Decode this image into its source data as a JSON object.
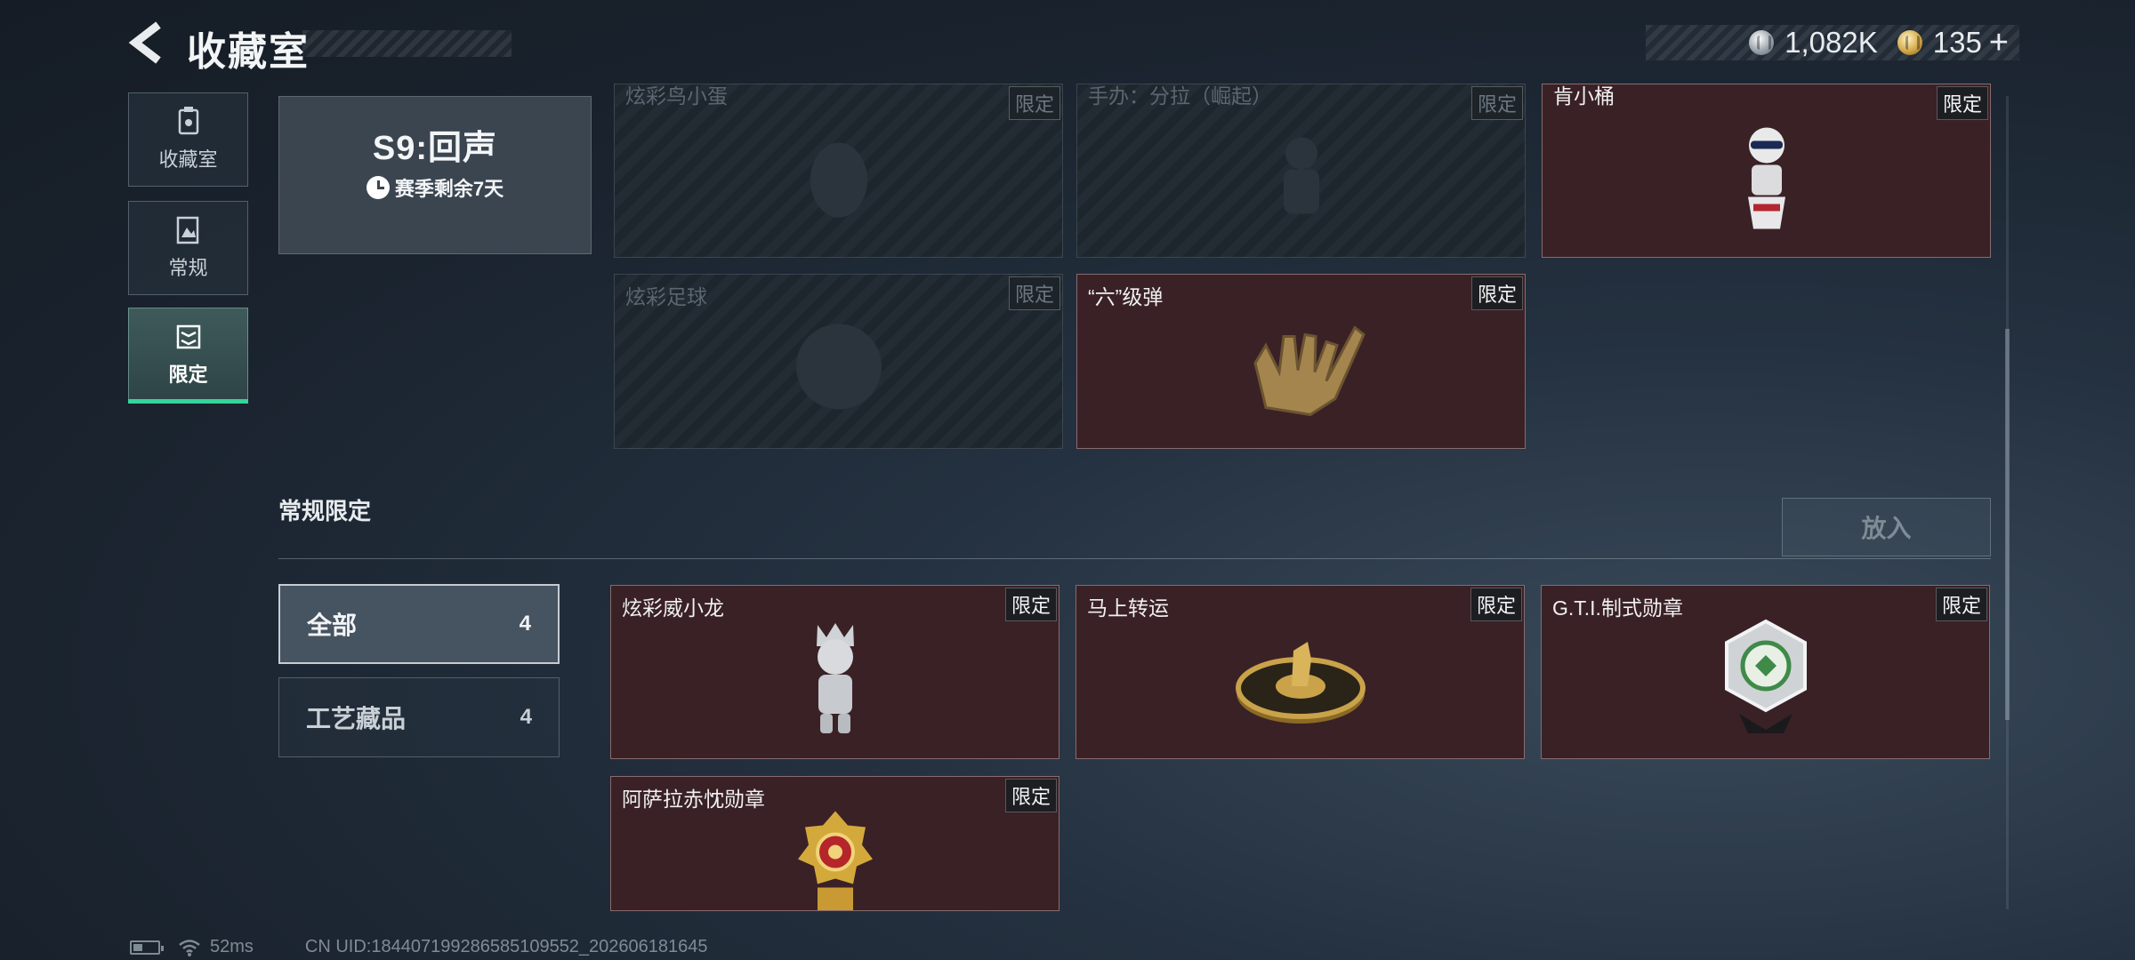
{
  "header": {
    "title": "收藏室",
    "currencies": [
      {
        "icon": "silver-coin-icon",
        "value": "1,082K"
      },
      {
        "icon": "gold-coin-icon",
        "value": "135"
      }
    ],
    "plus": "+"
  },
  "nav": {
    "items": [
      {
        "label": "收藏室",
        "icon": "collection-room-icon"
      },
      {
        "label": "常规",
        "icon": "regular-icon"
      },
      {
        "label": "限定",
        "icon": "limited-icon",
        "active": true
      }
    ]
  },
  "season": {
    "title": "S9:回声",
    "remaining": "赛季剩余7天"
  },
  "season_items": [
    {
      "name": "炫彩鸟小蛋",
      "tag": "限定",
      "owned": false,
      "art": "egg-figure"
    },
    {
      "name": "手办：分拉（崛起）",
      "tag": "限定",
      "owned": false,
      "art": "figure"
    },
    {
      "name": "肯小桶",
      "tag": "限定",
      "owned": true,
      "art": "bucket-mascot"
    },
    {
      "name": "炫彩足球",
      "tag": "限定",
      "owned": false,
      "art": "football"
    },
    {
      "name": "“六”级弹",
      "tag": "限定",
      "owned": true,
      "art": "golden-hand"
    }
  ],
  "section": {
    "title": "常规限定",
    "place_button": "放入",
    "filters": [
      {
        "label": "全部",
        "count": "4",
        "active": true
      },
      {
        "label": "工艺藏品",
        "count": "4",
        "active": false
      }
    ],
    "items": [
      {
        "name": "炫彩威小龙",
        "tag": "限定",
        "owned": true,
        "art": "silver-figure"
      },
      {
        "name": "马上转运",
        "tag": "限定",
        "owned": true,
        "art": "gold-coin-horse"
      },
      {
        "name": "G.T.I.制式勋章",
        "tag": "限定",
        "owned": true,
        "art": "gti-medal"
      },
      {
        "name": "阿萨拉赤忱勋章",
        "tag": "限定",
        "owned": true,
        "art": "gold-medal"
      }
    ]
  },
  "footer": {
    "ping": "52ms",
    "uid": "CN UID:18440719928658510​9552_202606181645"
  },
  "colors": {
    "accent": "#35d49a",
    "owned_card": "#3a2126",
    "tag_bg": "#1c1e22"
  }
}
